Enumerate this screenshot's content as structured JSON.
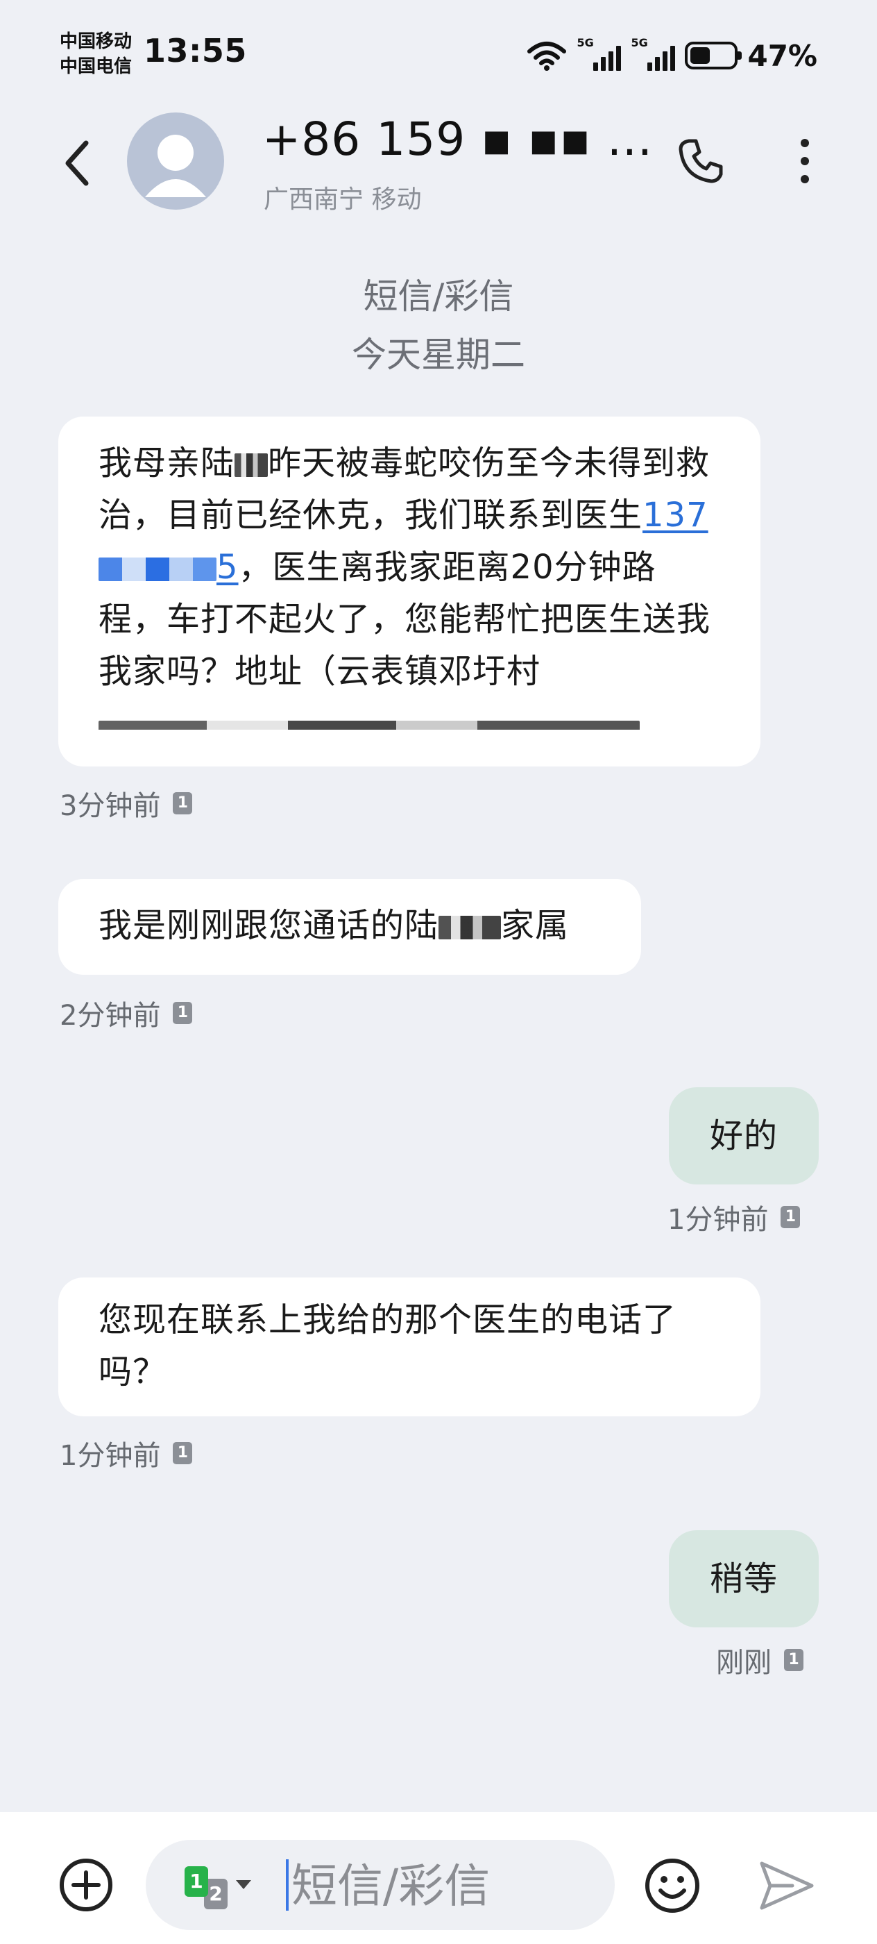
{
  "status_bar": {
    "carrier_1": "中国移动",
    "carrier_2": "中国电信",
    "time": "13:55",
    "signal_1_tag": "5G",
    "signal_2_tag": "5G",
    "battery_percent": "47%",
    "battery_level": 0.47
  },
  "header": {
    "contact_name": "+86 159 ▪ ▪▪ …",
    "contact_location": "广西南宁 移动",
    "icons": [
      "back-icon",
      "avatar-placeholder",
      "phone-icon",
      "more-vertical-icon"
    ]
  },
  "date_header": {
    "line1": "短信/彩信",
    "line2": "今天星期二"
  },
  "messages": [
    {
      "direction": "incoming",
      "parts": {
        "p1": "我母亲陆",
        "p2": "昨天被毒蛇咬伤至今未得到救治，目前已经休克，我们联系到医生",
        "link_prefix": "137",
        "link_suffix": "5",
        "p3": "，医生离我家距离20分钟路程，车打不起火了，您能帮忙把医生送我我家吗？地址（云表镇邓圩村"
      },
      "time": "3分钟前",
      "sim": "1"
    },
    {
      "direction": "incoming",
      "parts": {
        "p1": "我是刚刚跟您通话的陆",
        "p2": "家属"
      },
      "time": "2分钟前",
      "sim": "1"
    },
    {
      "direction": "outgoing",
      "text": "好的",
      "time": "1分钟前",
      "sim": "1"
    },
    {
      "direction": "incoming",
      "text": "您现在联系上我给的那个医生的电话了吗？",
      "time": "1分钟前",
      "sim": "1"
    },
    {
      "direction": "outgoing",
      "text": "稍等",
      "time": "刚刚",
      "sim": "1"
    }
  ],
  "composer": {
    "placeholder": "短信/彩信",
    "sim_1": "1",
    "sim_2": "2",
    "icons": [
      "add-circle-icon",
      "sim-switch-icon",
      "emoji-icon",
      "send-icon"
    ]
  },
  "colors": {
    "background": "#eef0f5",
    "incoming_bubble": "#ffffff",
    "outgoing_bubble": "#d7e7e1",
    "link": "#2a6fd8",
    "sim1_green": "#27b24a"
  }
}
